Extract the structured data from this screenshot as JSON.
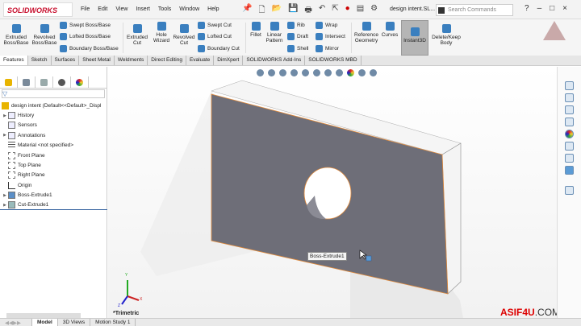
{
  "app": {
    "logo": "SOLIDWORKS",
    "document_title": "design intent.SL...",
    "search_placeholder": "Search Commands"
  },
  "menu": [
    "File",
    "Edit",
    "View",
    "Insert",
    "Tools",
    "Window",
    "Help"
  ],
  "ribbon": {
    "extruded_boss": "Extruded Boss/Base",
    "revolved_boss": "Revolved Boss/Base",
    "swept_boss": "Swept Boss/Base",
    "lofted_boss": "Lofted Boss/Base",
    "boundary_boss": "Boundary Boss/Base",
    "extruded_cut": "Extruded Cut",
    "hole_wizard": "Hole Wizard",
    "revolved_cut": "Revolved Cut",
    "swept_cut": "Swept Cut",
    "lofted_cut": "Lofted Cut",
    "boundary_cut": "Boundary Cut",
    "fillet": "Fillet",
    "linear_pattern": "Linear Pattern",
    "rib": "Rib",
    "draft": "Draft",
    "shell": "Shell",
    "wrap": "Wrap",
    "intersect": "Intersect",
    "mirror": "Mirror",
    "reference_geometry": "Reference Geometry",
    "curves": "Curves",
    "instant3d": "Instant3D",
    "delete_keep_body": "Delete/Keep Body"
  },
  "tabs": [
    "Features",
    "Sketch",
    "Surfaces",
    "Sheet Metal",
    "Weldments",
    "Direct Editing",
    "Evaluate",
    "DimXpert",
    "SOLIDWORKS Add-Ins",
    "SOLIDWORKS MBD"
  ],
  "tree": {
    "root": "design intent  (Default<<Default>_Displ",
    "items": [
      {
        "label": "History",
        "expand": true
      },
      {
        "label": "Sensors",
        "expand": false
      },
      {
        "label": "Annotations",
        "expand": true
      },
      {
        "label": "Material <not specified>",
        "expand": false
      },
      {
        "label": "Front Plane",
        "expand": false
      },
      {
        "label": "Top Plane",
        "expand": false
      },
      {
        "label": "Right Plane",
        "expand": false
      },
      {
        "label": "Origin",
        "expand": false
      },
      {
        "label": "Boss-Extrude1",
        "expand": true
      },
      {
        "label": "Cut-Extrude1",
        "expand": true
      }
    ]
  },
  "viewport": {
    "tooltip": "Boss-Extrude1",
    "view_name": "*Trimetric",
    "triad": {
      "x": "X",
      "y": "Y",
      "z": "Z"
    }
  },
  "watermark": {
    "brand": "ASIF4U",
    ".com": ".COM"
  },
  "bottom_tabs": [
    "Model",
    "3D Views",
    "Motion Study 1"
  ],
  "colors": {
    "part_face": "#6e6e78",
    "part_edge_highlight": "#e08a3c",
    "brand_red": "#c8102e"
  }
}
